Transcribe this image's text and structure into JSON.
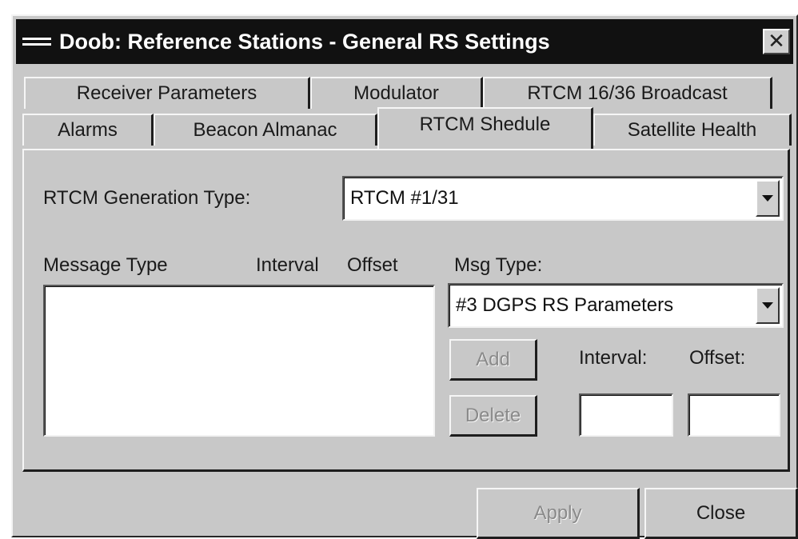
{
  "window": {
    "title": "Doob: Reference Stations - General RS Settings",
    "close_symbol": "✕"
  },
  "tabs": {
    "row1": [
      "Receiver Parameters",
      "Modulator",
      "RTCM 16/36 Broadcast"
    ],
    "row2": [
      "Alarms",
      "Beacon Almanac",
      "RTCM Shedule",
      "Satellite Health"
    ],
    "active": "RTCM Shedule"
  },
  "rtcm": {
    "generation_type_label": "RTCM Generation Type:",
    "generation_type_value": "RTCM #1/31"
  },
  "list": {
    "columns": [
      "Message Type",
      "Interval",
      "Offset"
    ],
    "rows": []
  },
  "msg": {
    "type_label": "Msg Type:",
    "type_value": "#3 DGPS RS Parameters",
    "add_label": "Add",
    "delete_label": "Delete",
    "interval_label": "Interval:",
    "offset_label": "Offset:",
    "interval_value": "",
    "offset_value": ""
  },
  "footer": {
    "apply_label": "Apply",
    "close_label": "Close"
  },
  "icons": {
    "system_menu": "system-menu-icon",
    "close": "close-icon",
    "dropdown": "chevron-down-icon"
  }
}
